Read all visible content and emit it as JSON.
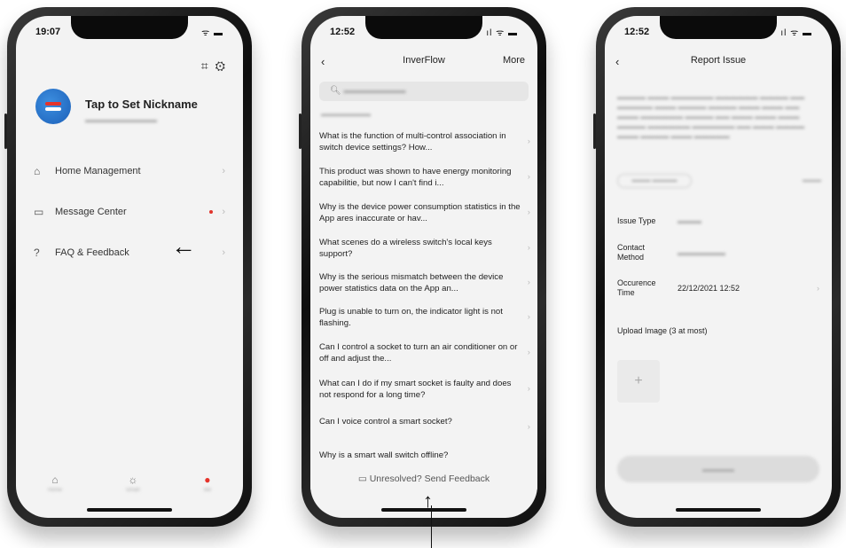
{
  "phone1": {
    "status_time": "19:07",
    "nickname": "Tap to Set Nickname",
    "menu": [
      {
        "label": "Home Management",
        "icon": "home-icon"
      },
      {
        "label": "Message Center",
        "icon": "message-icon"
      },
      {
        "label": "FAQ & Feedback",
        "icon": "help-icon"
      }
    ],
    "tabs": [
      {
        "icon": "home-icon",
        "label": "Home"
      },
      {
        "icon": "scene-icon",
        "label": "Smart"
      },
      {
        "icon": "profile-icon",
        "label": "Me"
      }
    ]
  },
  "phone2": {
    "status_time": "12:52",
    "nav_title": "InverFlow",
    "nav_more": "More",
    "faq_items": [
      "What is the function of multi-control association in switch device settings? How...",
      "This product was shown to have energy monitoring capabilitie, but now I can't find i...",
      "Why is the device power consumption statistics in the App ares inaccurate or hav...",
      "What scenes do a wireless switch's local keys support?",
      "Why is the serious mismatch between the device power statistics data on the App an...",
      "Plug is unable to turn on, the indicator light is not flashing.",
      "Can I control a socket to turn an air conditioner on or off and adjust the...",
      "What can I do if my smart socket is faulty and does not respond for a long time?",
      "Can I voice control a smart socket?",
      "Why is a smart wall switch offline?"
    ],
    "feedback_label": "Unresolved? Send Feedback"
  },
  "phone3": {
    "status_time": "12:52",
    "nav_title": "Report Issue",
    "issue_type_label": "Issue Type",
    "contact_label": "Contact Method",
    "occurrence_label": "Occurence Time",
    "occurrence_value": "22/12/2021 12:52",
    "upload_label": "Upload Image (3 at most)"
  },
  "annotations": {
    "left_arrow": "←",
    "up_arrow": "↑"
  },
  "colors": {
    "accent_red": "#e5332a",
    "brand_blue": "#1b5fb8"
  }
}
